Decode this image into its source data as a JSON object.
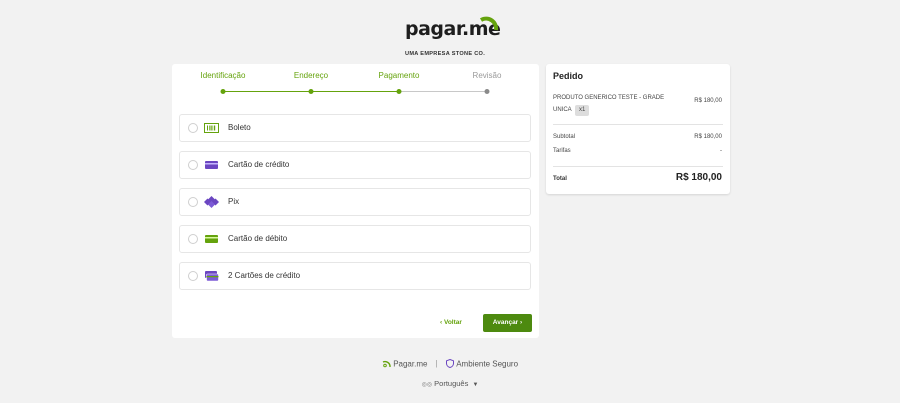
{
  "brand": {
    "name": "pagar.me",
    "tagline": "UMA EMPRESA STONE CO.",
    "accent": "#65a30d",
    "button_color": "#4d8a0f",
    "icon_purple": "#6b46c1"
  },
  "steps": [
    {
      "label": "Identificação",
      "status": "done"
    },
    {
      "label": "Endereço",
      "status": "done"
    },
    {
      "label": "Pagamento",
      "status": "current"
    },
    {
      "label": "Revisão",
      "status": "todo"
    }
  ],
  "payment_options": [
    {
      "label": "Boleto",
      "icon": "barcode-icon"
    },
    {
      "label": "Cartão de crédito",
      "icon": "credit-card-icon"
    },
    {
      "label": "Pix",
      "icon": "pix-icon"
    },
    {
      "label": "Cartão de débito",
      "icon": "debit-card-icon"
    },
    {
      "label": "2 Cartões de crédito",
      "icon": "two-cards-icon"
    }
  ],
  "actions": {
    "back": "‹ Voltar",
    "next": "Avançar ›"
  },
  "order": {
    "title": "Pedido",
    "product_name": "PRODUTO GENERICO TESTE - GRADE UNICA",
    "quantity": "x1",
    "product_price": "R$ 180,00",
    "subtotal_label": "Subtotal",
    "subtotal_value": "R$ 180,00",
    "fees_label": "Tarifas",
    "fees_value": "-",
    "total_label": "Total",
    "total_value": "R$ 180,00"
  },
  "footer": {
    "brand": "Pagar.me",
    "separator": "|",
    "secure": "Ambiente Seguro",
    "language": "Português"
  }
}
